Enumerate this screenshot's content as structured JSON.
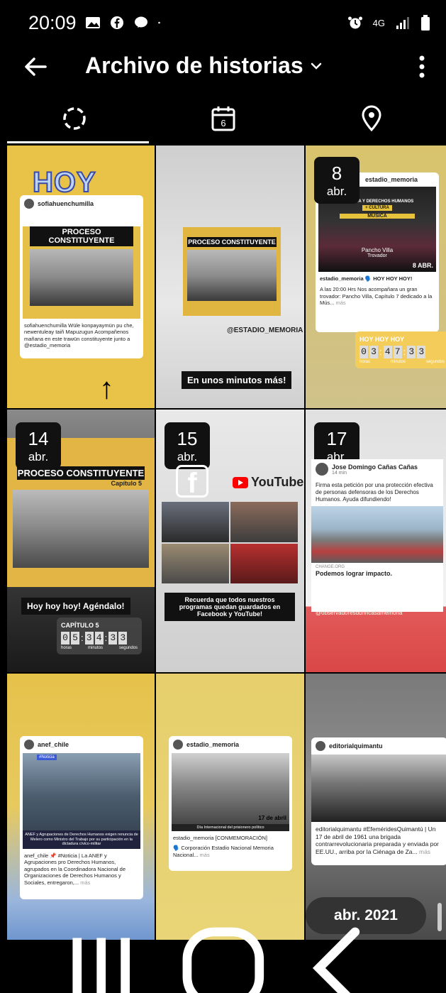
{
  "status": {
    "time": "20:09",
    "network": "4G"
  },
  "header": {
    "title": "Archivo de historias"
  },
  "tabs": [
    {
      "name": "stories",
      "icon": "loading-circle-icon"
    },
    {
      "name": "calendar",
      "icon": "calendar-icon",
      "day": "6"
    },
    {
      "name": "map",
      "icon": "location-pin-icon"
    }
  ],
  "stories": [
    {
      "hoy": "HOY",
      "user": "sofiahuenchumilla",
      "poster_title": "PROCESO CONSTITUYENTE",
      "caption": "sofiahuenchumilla Wüle konpayaymün pu che, newentuleay taiñ Mapuzugun Acompañenos mañana en este trawün constituyente junto a @estadio_memoria"
    },
    {
      "poster_title": "PROCESO CONSTITUYENTE",
      "handle": "@ESTADIO_MEMORIA",
      "banner": "En unos minutos más!"
    },
    {
      "date_day": "8",
      "date_month": "abr.",
      "user": "estadio_memoria",
      "poster_line1": "MEMORIA Y DERECHOS HUMANOS",
      "poster_line2": "+ CULTURA",
      "poster_line3": "MÚSICA",
      "artist": "Pancho Villa",
      "artist_role": "Trovador",
      "caption_head": "estadio_memoria 🗣️ HOY HOY HOY!",
      "caption": "A las 20:00 Hrs  Nos acompañara un gran trovador: Pancho Villa, Capítulo 7 dedicado a la Mús...",
      "more": "más",
      "cd_title": "HOY HOY HOY",
      "cd_digits": [
        "0",
        "3",
        "4",
        "7",
        "3",
        "3"
      ],
      "cd_labels": [
        "horas",
        "minutos",
        "segundos"
      ],
      "badge_date": "8 ABR."
    },
    {
      "date_day": "14",
      "date_month": "abr.",
      "poster_title": "PROCESO CONSTITUYENTE",
      "poster_sub": "Capítulo 5",
      "banner": "Hoy hoy hoy! Agéndalo!",
      "cd_title": "CAPÍTULO 5",
      "cd_digits": [
        "0",
        "5",
        "3",
        "4",
        "3",
        "3"
      ],
      "cd_labels": [
        "horas",
        "minutos",
        "segundos"
      ]
    },
    {
      "date_day": "15",
      "date_month": "abr.",
      "yt_label": "YouTube",
      "banner": "Recuerda que todos nuestros programas quedan guardados en Facebook y YouTube!"
    },
    {
      "date_day": "17",
      "date_month": "abr.",
      "author": "Jose Domingo Cañas Cañas",
      "time_ago": "14 min",
      "text": "Firma esta petición por una protección efectiva de personas defensoras de los Derechos Humanos. Ayuda difundiendo!",
      "domain": "CHANGE.ORG",
      "link_title": "Podemos lograr impacto.",
      "handle": "@observadoresddhhcasamemoria"
    },
    {
      "user": "anef_chile",
      "tag": "#Noticia",
      "headline": "ANEF y Agrupaciones de Derechos Humanos exigen renuncia de Melero como Ministro del Trabajo por su participación en la dictadura cívico-militar",
      "caption": "anef_chile 📌 #Noticia | La ANEF y Agrupaciones pro Derechos Humanos, agrupados en la Coordinadora Nacional de Organizaciones de Derechos Humanos y Sociales, entregaron,...",
      "more": "más"
    },
    {
      "user": "estadio_memoria",
      "date_label": "17 de abril",
      "sub_label": "Día Internacional del prisionero político",
      "caption": "estadio_memoria [CONMEMORACIÓN]",
      "caption2": "🗣️ Corporación Estadio Nacional Memoria Nacional...",
      "more": "más"
    },
    {
      "user": "editorialquimantu",
      "caption": "editorialquimantu #EfeméridesQuimantú | Un 17 de abril de 1961 una brigada contrarrevolucionaria preparada y enviada por EE.UU., arriba por la Ciénaga de Za...",
      "more": "más",
      "pill": "abr. 2021"
    }
  ],
  "colors": {
    "bg": "#000000",
    "yellow": "#e9c347",
    "accent_red": "#d94747"
  }
}
